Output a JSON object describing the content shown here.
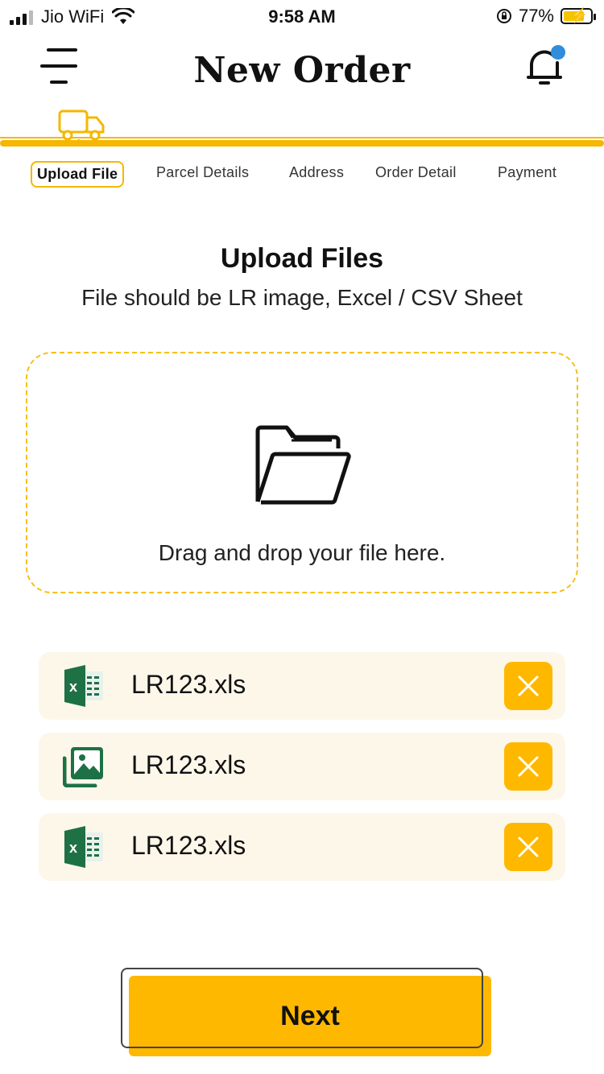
{
  "status_bar": {
    "carrier": "Jio WiFi",
    "time": "9:58 AM",
    "battery_percent": "77%",
    "battery_level": 0.77,
    "signal_icon": "cellular-signal-icon",
    "wifi_icon": "wifi-icon",
    "lock_icon": "rotation-lock-icon",
    "battery_icon": "battery-charging-icon"
  },
  "header": {
    "title": "New Order",
    "menu_icon": "hamburger-menu-icon",
    "bell_icon": "notification-bell-icon",
    "has_notification": true
  },
  "stepper": {
    "icon": "truck-icon",
    "steps": [
      {
        "label": "Upload File",
        "active": true
      },
      {
        "label": "Parcel Details",
        "active": false
      },
      {
        "label": "Address",
        "active": false
      },
      {
        "label": "Order Detail",
        "active": false
      },
      {
        "label": "Payment",
        "active": false
      }
    ]
  },
  "upload": {
    "title": "Upload Files",
    "subtitle": "File should be LR image, Excel / CSV Sheet",
    "dropzone_icon": "folder-open-icon",
    "dropzone_text": "Drag and drop your file here."
  },
  "files": [
    {
      "name": "LR123.xls",
      "icon": "excel-file-icon"
    },
    {
      "name": "LR123.xls",
      "icon": "image-file-icon"
    },
    {
      "name": "LR123.xls",
      "icon": "excel-file-icon"
    }
  ],
  "actions": {
    "next_label": "Next"
  },
  "colors": {
    "accent": "#ffb800",
    "dashed_border": "#f5c01a",
    "file_row_bg": "#fdf7ea",
    "notification_dot": "#2f8ddc",
    "excel_green": "#1e7145"
  }
}
